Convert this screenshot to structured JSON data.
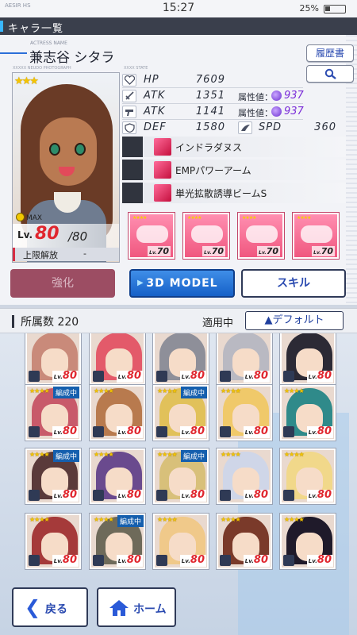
{
  "status": {
    "logo": "AESIR HS",
    "time": "15:27",
    "battery": "25%"
  },
  "header": {
    "title": "キャラ一覧"
  },
  "character": {
    "name_caption": "ACTRESS NAME",
    "name": "兼志谷 シタラ",
    "photo_caption": "XXXXX NEUDO PHOTOGRAPH",
    "state_caption": "XXXX STATE",
    "rarity_stars": "★★★",
    "max_label": "MAX",
    "level_prefix": "Lv.",
    "level": "80",
    "level_max": "/80",
    "limit_label": "上限解放",
    "limit_value": "-"
  },
  "buttons": {
    "history": "履歴書",
    "search_icon": "search-icon",
    "enhance": "強化",
    "model_3d": "3D MODEL",
    "skill": "スキル"
  },
  "stats": [
    {
      "icon": "heart-icon",
      "label": "HP",
      "value": "7609"
    },
    {
      "icon": "sword-icon",
      "label": "ATK",
      "value": "1351",
      "attr_label": "属性値：",
      "attr_value": "937"
    },
    {
      "icon": "gun-icon",
      "label": "ATK",
      "value": "1141",
      "attr_label": "属性値：",
      "attr_value": "937"
    },
    {
      "icon": "shield-icon",
      "label": "DEF",
      "value": "1580",
      "spd_label": "SPD",
      "spd_value": "360"
    }
  ],
  "skills": [
    {
      "name": "インドラダヌス"
    },
    {
      "name": "EMPパワーアーム"
    },
    {
      "name": "単光拡散誘導ビームS"
    }
  ],
  "equipment": [
    {
      "stars": "★★★★",
      "level": "70"
    },
    {
      "stars": "★★★★",
      "level": "70"
    },
    {
      "stars": "★★★★",
      "level": "70"
    },
    {
      "stars": "★★★★",
      "level": "70"
    }
  ],
  "list": {
    "count_label": "所属数",
    "count": "220",
    "applied_label": "適用中",
    "sort_label": "▲デフォルト"
  },
  "cards": [
    {
      "level": "80",
      "team": "",
      "stars": "",
      "hair": "#c98a7a"
    },
    {
      "level": "80",
      "team": "",
      "stars": "",
      "hair": "#e35a6a"
    },
    {
      "level": "80",
      "team": "",
      "stars": "",
      "hair": "#8e8f99"
    },
    {
      "level": "80",
      "team": "",
      "stars": "",
      "hair": "#b9b9c2"
    },
    {
      "level": "80",
      "team": "",
      "stars": "",
      "hair": "#2c2a35"
    },
    {
      "level": "80",
      "team": "編成中",
      "stars": "★★★★",
      "hair": "#c85a6a"
    },
    {
      "level": "80",
      "team": "",
      "stars": "★★★★",
      "hair": "#b87a4e"
    },
    {
      "level": "80",
      "team": "編成中",
      "stars": "★★★★",
      "hair": "#e1c15a"
    },
    {
      "level": "80",
      "team": "",
      "stars": "★★★★",
      "hair": "#f0c96a"
    },
    {
      "level": "80",
      "team": "",
      "stars": "★★★★",
      "hair": "#2f8a8a"
    },
    {
      "level": "80",
      "team": "編成中",
      "stars": "★★★★",
      "hair": "#5a3a3a"
    },
    {
      "level": "80",
      "team": "",
      "stars": "★★★★",
      "hair": "#6a4a8e"
    },
    {
      "level": "80",
      "team": "編成中",
      "stars": "★★★★",
      "hair": "#d8c07a"
    },
    {
      "level": "80",
      "team": "",
      "stars": "★★★★",
      "hair": "#cfd6e8"
    },
    {
      "level": "80",
      "team": "",
      "stars": "★★★★",
      "hair": "#f1d88a"
    },
    {
      "level": "80",
      "team": "",
      "stars": "★★★★",
      "hair": "#a53a3a"
    },
    {
      "level": "80",
      "team": "編成中",
      "stars": "★★★★",
      "hair": "#6e6a5a"
    },
    {
      "level": "80",
      "team": "",
      "stars": "★★★★",
      "hair": "#f0c98a"
    },
    {
      "level": "80",
      "team": "",
      "stars": "★★★★",
      "hair": "#7a3a2a"
    },
    {
      "level": "80",
      "team": "",
      "stars": "★★★★",
      "hair": "#1f1a2a"
    }
  ],
  "nav": {
    "back": "戻る",
    "home": "ホーム"
  },
  "colors": {
    "accent": "#2a4ab0",
    "level_red": "#e0262e",
    "attr_purple": "#7a2bd8",
    "team_badge": "#155fae"
  }
}
